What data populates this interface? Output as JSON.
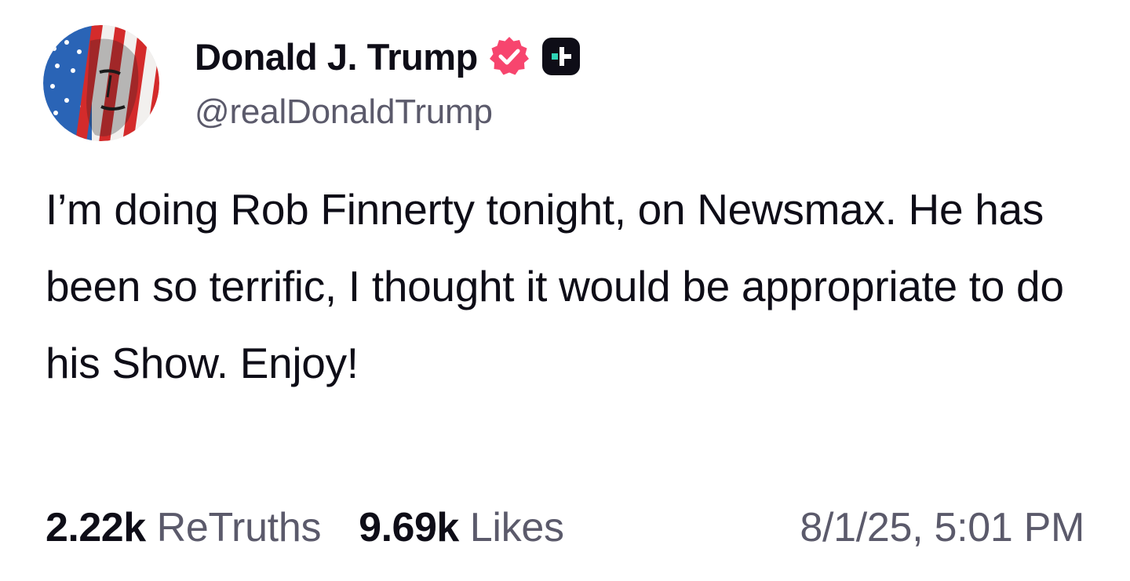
{
  "author": {
    "display_name": "Donald J. Trump",
    "handle": "@realDonaldTrump",
    "verified_color": "#f7456e"
  },
  "post": {
    "text": "I’m doing Rob Finnerty tonight, on Newsmax. He has been so terrific, I thought it would be appropriate to do his Show. Enjoy!"
  },
  "stats": {
    "retruths_count": "2.22k",
    "retruths_label": "ReTruths",
    "likes_count": "9.69k",
    "likes_label": "Likes"
  },
  "timestamp": "8/1/25, 5:01 PM",
  "icons": {
    "verified": "verified-badge-icon",
    "plus": "truth-plus-icon"
  }
}
